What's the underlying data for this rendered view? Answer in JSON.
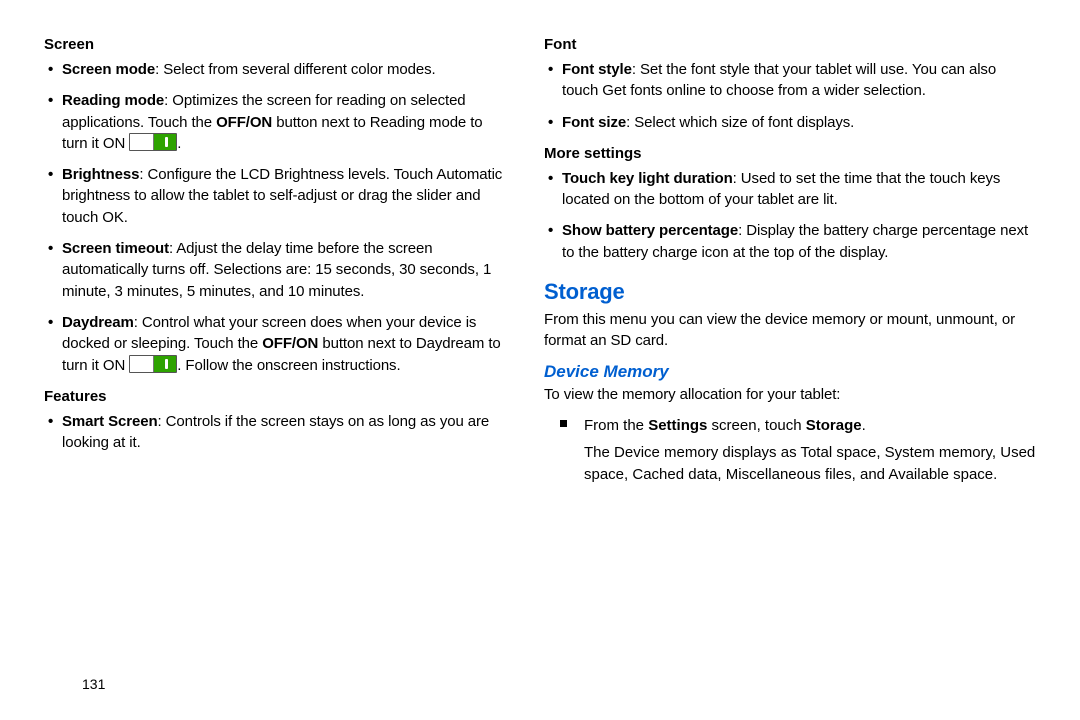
{
  "leftCol": {
    "screen": {
      "heading": "Screen",
      "items": {
        "screenMode": {
          "label": "Screen mode",
          "text": ": Select from several different color modes."
        },
        "readingMode": {
          "label": "Reading mode",
          "text1": ": Optimizes the screen for reading on selected applications. Touch the ",
          "offon": "OFF/ON",
          "text2": " button next to Reading mode to turn it ON ",
          "text3": "."
        },
        "brightness": {
          "label": "Brightness",
          "text": ": Configure the LCD Brightness levels. Touch Automatic brightness to allow the tablet to self-adjust or drag the slider and touch OK."
        },
        "screenTimeout": {
          "label": "Screen timeout",
          "text": ": Adjust the delay time before the screen automatically turns off. Selections are: 15 seconds, 30 seconds, 1 minute, 3 minutes, 5 minutes, and 10 minutes."
        },
        "daydream": {
          "label": "Daydream",
          "text1": ": Control what your screen does when your device is docked or sleeping. Touch the ",
          "offon": "OFF/ON",
          "text2": " button next to Daydream to turn it ON ",
          "text3": ". Follow the onscreen instructions."
        }
      }
    },
    "features": {
      "heading": "Features",
      "items": {
        "smartScreen": {
          "label": "Smart Screen",
          "text": ": Controls if the screen stays on as long as you are looking at it."
        }
      }
    }
  },
  "rightCol": {
    "font": {
      "heading": "Font",
      "items": {
        "fontStyle": {
          "label": "Font style",
          "text": ": Set the font style that your tablet will use. You can also touch Get fonts online to choose from a wider selection."
        },
        "fontSize": {
          "label": "Font size",
          "text": ": Select which size of font displays."
        }
      }
    },
    "moreSettings": {
      "heading": "More settings",
      "items": {
        "touchKey": {
          "label": "Touch key light duration",
          "text": ": Used to set the time that the touch keys located on the bottom of your tablet are lit."
        },
        "batteryPct": {
          "label": "Show battery percentage",
          "text": ": Display the battery charge percentage next to the battery charge icon at the top of the display."
        }
      }
    },
    "storage": {
      "heading": "Storage",
      "intro": "From this menu you can view the device memory or mount, unmount, or format an SD card.",
      "deviceMemory": {
        "heading": "Device Memory",
        "intro": "To view the memory allocation for your tablet:",
        "step": {
          "pre": "From the ",
          "settings": "Settings",
          "mid": " screen, touch ",
          "storage": "Storage",
          "post": "."
        },
        "result": "The Device memory displays as Total space, System memory, Used space, Cached data, Miscellaneous files, and Available space."
      }
    }
  },
  "pageNumber": "131"
}
